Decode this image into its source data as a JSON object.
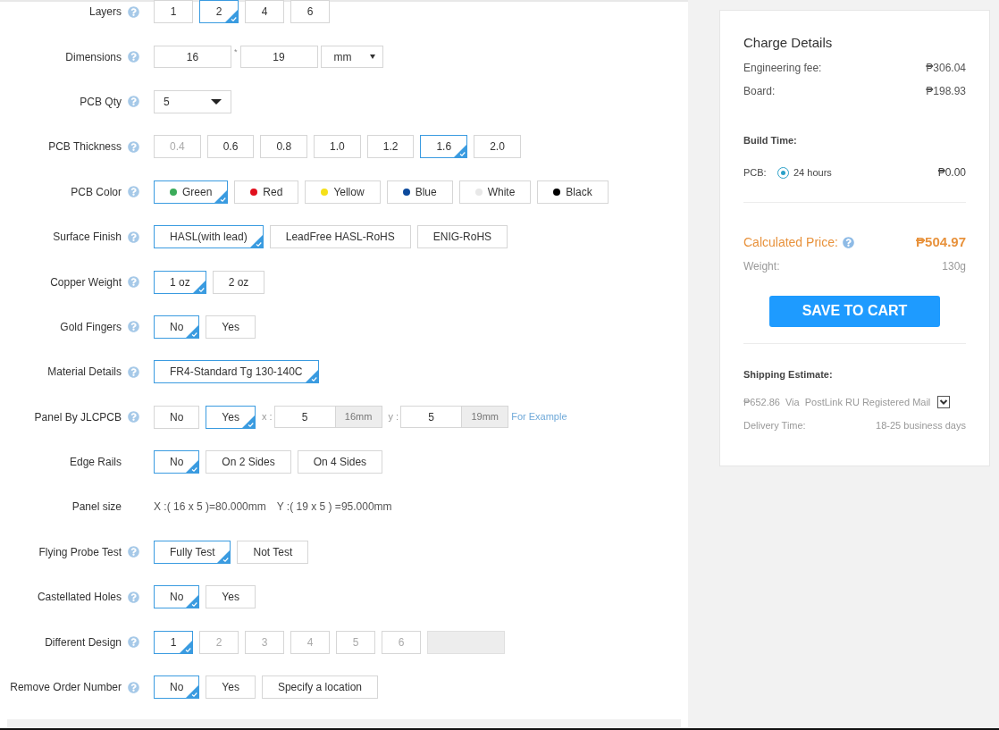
{
  "form": {
    "rows": [
      {
        "label": "Layers",
        "help": true,
        "kind": "options",
        "options": [
          {
            "label": "1",
            "selected": false,
            "disabled": false
          },
          {
            "label": "2",
            "selected": true,
            "disabled": false
          },
          {
            "label": "4",
            "selected": false,
            "disabled": false
          },
          {
            "label": "6",
            "selected": false,
            "disabled": false
          }
        ]
      },
      {
        "label": "Dimensions",
        "help": true,
        "kind": "dimensions",
        "values": [
          "16",
          "19"
        ],
        "separator": "*",
        "unit": "mm"
      },
      {
        "label": "PCB Qty",
        "help": true,
        "kind": "select",
        "value": "5"
      },
      {
        "label": "PCB Thickness",
        "help": true,
        "kind": "options",
        "options": [
          {
            "label": "0.4",
            "selected": false,
            "disabled": true
          },
          {
            "label": "0.6",
            "selected": false,
            "disabled": false
          },
          {
            "label": "0.8",
            "selected": false,
            "disabled": false
          },
          {
            "label": "1.0",
            "selected": false,
            "disabled": false
          },
          {
            "label": "1.2",
            "selected": false,
            "disabled": false
          },
          {
            "label": "1.6",
            "selected": true,
            "disabled": false
          },
          {
            "label": "2.0",
            "selected": false,
            "disabled": false
          }
        ]
      },
      {
        "label": "PCB Color",
        "help": true,
        "kind": "colors",
        "options": [
          {
            "label": "Green",
            "color": "#3bab5a",
            "selected": true
          },
          {
            "label": "Red",
            "color": "#e0101d",
            "selected": false
          },
          {
            "label": "Yellow",
            "color": "#f5e01a",
            "selected": false
          },
          {
            "label": "Blue",
            "color": "#0c4a9c",
            "selected": false
          },
          {
            "label": "White",
            "color": "#e8e8e8",
            "selected": false
          },
          {
            "label": "Black",
            "color": "#000000",
            "selected": false
          }
        ]
      },
      {
        "label": "Surface Finish",
        "help": true,
        "kind": "options",
        "options": [
          {
            "label": "HASL(with lead)",
            "selected": true,
            "disabled": false
          },
          {
            "label": "LeadFree HASL-RoHS",
            "selected": false,
            "disabled": false
          },
          {
            "label": "ENIG-RoHS",
            "selected": false,
            "disabled": false
          }
        ]
      },
      {
        "label": "Copper Weight",
        "help": true,
        "kind": "options",
        "options": [
          {
            "label": "1 oz",
            "selected": true,
            "disabled": false
          },
          {
            "label": "2 oz",
            "selected": false,
            "disabled": false
          }
        ]
      },
      {
        "label": "Gold Fingers",
        "help": true,
        "kind": "options",
        "options": [
          {
            "label": "No",
            "selected": true,
            "disabled": false
          },
          {
            "label": "Yes",
            "selected": false,
            "disabled": false
          }
        ]
      },
      {
        "label": "Material Details",
        "help": true,
        "kind": "options",
        "options": [
          {
            "label": "FR4-Standard Tg 130-140C",
            "selected": true,
            "disabled": false
          }
        ]
      },
      {
        "label": "Panel By JLCPCB",
        "help": true,
        "kind": "panel",
        "options": [
          {
            "label": "No",
            "selected": false,
            "disabled": false
          },
          {
            "label": "Yes",
            "selected": true,
            "disabled": false
          }
        ],
        "axes": [
          {
            "label": "x :",
            "value": "5",
            "unit": "16mm"
          },
          {
            "label": "y :",
            "value": "5",
            "unit": "19mm"
          }
        ],
        "link": "For Example"
      },
      {
        "label": "Edge Rails",
        "help": false,
        "kind": "options",
        "options": [
          {
            "label": "No",
            "selected": true,
            "disabled": false
          },
          {
            "label": "On 2 Sides",
            "selected": false,
            "disabled": false
          },
          {
            "label": "On 4 Sides",
            "selected": false,
            "disabled": false
          }
        ]
      },
      {
        "label": "Panel size",
        "help": false,
        "kind": "text",
        "texts": [
          "X :( 16 x 5 )=80.000mm",
          "Y :( 19 x 5 ) =95.000mm"
        ]
      },
      {
        "label": "Flying Probe Test",
        "help": true,
        "kind": "options",
        "options": [
          {
            "label": "Fully Test",
            "selected": true,
            "disabled": false
          },
          {
            "label": "Not Test",
            "selected": false,
            "disabled": false
          }
        ]
      },
      {
        "label": "Castellated Holes",
        "help": true,
        "kind": "options",
        "options": [
          {
            "label": "No",
            "selected": true,
            "disabled": false
          },
          {
            "label": "Yes",
            "selected": false,
            "disabled": false
          }
        ]
      },
      {
        "label": "Different Design",
        "help": true,
        "kind": "options",
        "options": [
          {
            "label": "1",
            "selected": true,
            "disabled": false
          },
          {
            "label": "2",
            "selected": false,
            "disabled": true
          },
          {
            "label": "3",
            "selected": false,
            "disabled": true
          },
          {
            "label": "4",
            "selected": false,
            "disabled": true
          },
          {
            "label": "5",
            "selected": false,
            "disabled": true
          },
          {
            "label": "6",
            "selected": false,
            "disabled": true
          }
        ],
        "extra_field": {
          "disabled": true
        }
      },
      {
        "label": "Remove Order Number",
        "help": true,
        "kind": "options",
        "options": [
          {
            "label": "No",
            "selected": true,
            "disabled": false
          },
          {
            "label": "Yes",
            "selected": false,
            "disabled": false
          },
          {
            "label": "Specify a location",
            "selected": false,
            "disabled": false
          }
        ]
      }
    ]
  },
  "charges": {
    "title": "Charge Details",
    "fees": [
      {
        "label": "Engineering fee:",
        "amount": "₱306.04"
      },
      {
        "label": "Board:",
        "amount": "₱198.93"
      }
    ],
    "build_time": {
      "title": "Build Time:",
      "label": "PCB:",
      "options": [
        {
          "label": "24 hours",
          "selected": true,
          "amount": "₱0.00"
        }
      ]
    },
    "total": {
      "label": "Calculated Price:",
      "amount": "₱504.97"
    },
    "weight": {
      "label": "Weight:",
      "value": "130g"
    },
    "save_button": "SAVE TO CART",
    "shipping": {
      "title": "Shipping Estimate:",
      "cost": "₱652.86",
      "via": "Via",
      "carrier": "PostLink RU Registered Mail",
      "delivery_label": "Delivery Time:",
      "delivery_value": "18-25 business days"
    }
  }
}
